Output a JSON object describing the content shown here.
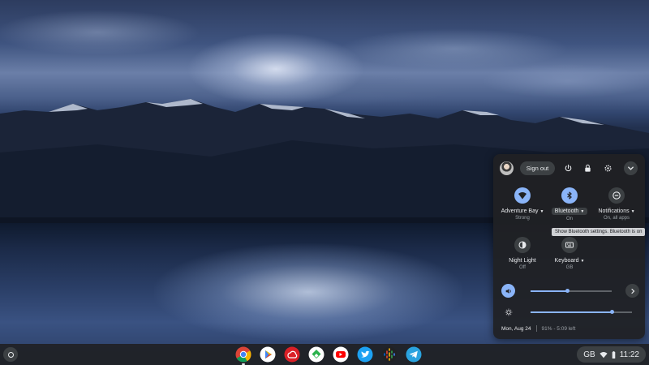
{
  "quick_settings": {
    "sign_out_label": "Sign out",
    "features": {
      "network": {
        "label": "Adventure Bay",
        "status": "Strong"
      },
      "bluetooth": {
        "label": "Bluetooth",
        "status": "On"
      },
      "notifications": {
        "label": "Notifications",
        "status": "On, all apps"
      },
      "night_light": {
        "label": "Night Light",
        "status": "Off"
      },
      "keyboard": {
        "label": "Keyboard",
        "status": "GB"
      }
    },
    "tooltip": "Show Bluetooth settings. Bluetooth is on",
    "volume_level": 0.45,
    "brightness_level": 0.8,
    "date": "Mon, Aug 24",
    "battery": "91% - 5:09 left"
  },
  "shelf": {
    "apps": [
      "Chrome",
      "Play Store",
      "Creative Cloud",
      "Feedly",
      "YouTube",
      "Twitter",
      "Google Podcasts",
      "Telegram"
    ],
    "status": {
      "keyboard_layout": "GB",
      "time": "11:22"
    }
  },
  "colors": {
    "accent": "#8ab4f8",
    "bubble": "#202124",
    "button": "#3c4043"
  }
}
